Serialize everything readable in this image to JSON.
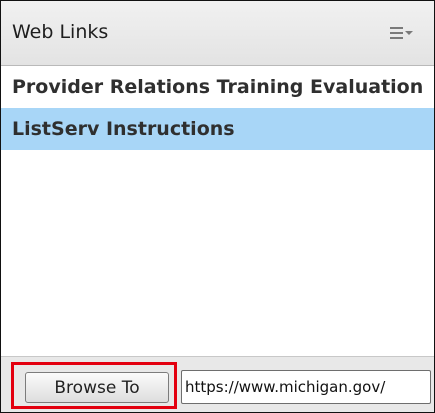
{
  "pod": {
    "title": "Web Links",
    "menu_icon": "hamburger-menu-dropdown-icon"
  },
  "list": {
    "items": [
      {
        "label": "Provider Relations Training Evaluation",
        "selected": false
      },
      {
        "label": "ListServ Instructions",
        "selected": true
      }
    ]
  },
  "footer": {
    "browse_label": "Browse To",
    "url_value": "https://www.michigan.gov/",
    "highlight_color": "#e3000f"
  },
  "colors": {
    "selection": "#a8d6f7",
    "header": "#e9e9e9",
    "footer": "#e8e8e8"
  }
}
